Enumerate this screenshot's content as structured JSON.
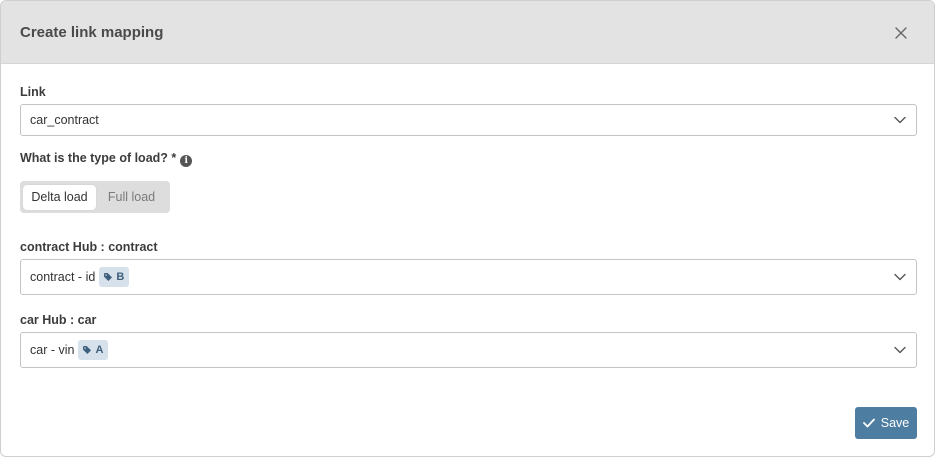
{
  "dialog": {
    "title": "Create link mapping",
    "close_icon": "close-icon"
  },
  "link_field": {
    "label": "Link",
    "value": "car_contract"
  },
  "load_type": {
    "label": "What is the type of load? *",
    "info_icon": "info-icon",
    "options": [
      "Delta load",
      "Full load"
    ],
    "selected": "Delta load"
  },
  "contract_hub": {
    "label": "contract Hub : contract",
    "value": "contract - id",
    "tag": "B",
    "tag_icon": "tag-icon"
  },
  "car_hub": {
    "label": "car Hub : car",
    "value": "car - vin",
    "tag": "A",
    "tag_icon": "tag-icon"
  },
  "footer": {
    "save_label": "Save",
    "save_icon": "check-icon"
  },
  "colors": {
    "header_bg": "#e3e3e3",
    "primary": "#4d7ea2",
    "tag_bg": "#d6e1eb",
    "tag_text": "#3e5f7c"
  }
}
